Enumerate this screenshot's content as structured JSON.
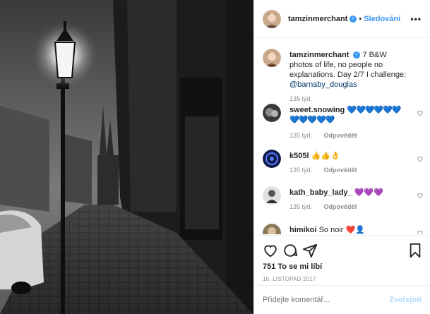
{
  "post": {
    "author": "tamzinmerchant",
    "follow_label": "Sledování",
    "more_label": "•••",
    "verified_mark": "✓"
  },
  "caption": {
    "username": "tamzinmerchant",
    "text": "7 B&W photos of life, no people no explanations. Day 2/7 I challenge: ",
    "mention": "@barnaby_douglas",
    "time": "135 týd."
  },
  "comments": [
    {
      "username": "sweet.snowing",
      "text": "💙💙💙💙💙💙💙💙💙💙💙",
      "time": "135 týd.",
      "reply": "Odpovědět"
    },
    {
      "username": "k505l",
      "text": "👍👍👌",
      "time": "135 týd.",
      "reply": "Odpovědět"
    },
    {
      "username": "kath_baby_lady_",
      "text": "💜💜💜",
      "time": "135 týd.",
      "reply": "Odpovědět"
    },
    {
      "username": "himikoi",
      "text": "So noir ❤️👤",
      "time": "",
      "reply": ""
    }
  ],
  "stats": {
    "likes": "751 To se mi líbí",
    "date": "16. LISTOPAD 2017"
  },
  "comment_box": {
    "placeholder": "Přidejte komentář...",
    "post_label": "Zveřejnit"
  },
  "icons": {
    "like": "heart-icon",
    "comment": "comment-icon",
    "share": "share-icon",
    "save": "bookmark-icon"
  },
  "colors": {
    "link": "#3897f0",
    "text": "#262626",
    "muted": "#8e8e8e",
    "post_disabled": "#b3dbff"
  }
}
